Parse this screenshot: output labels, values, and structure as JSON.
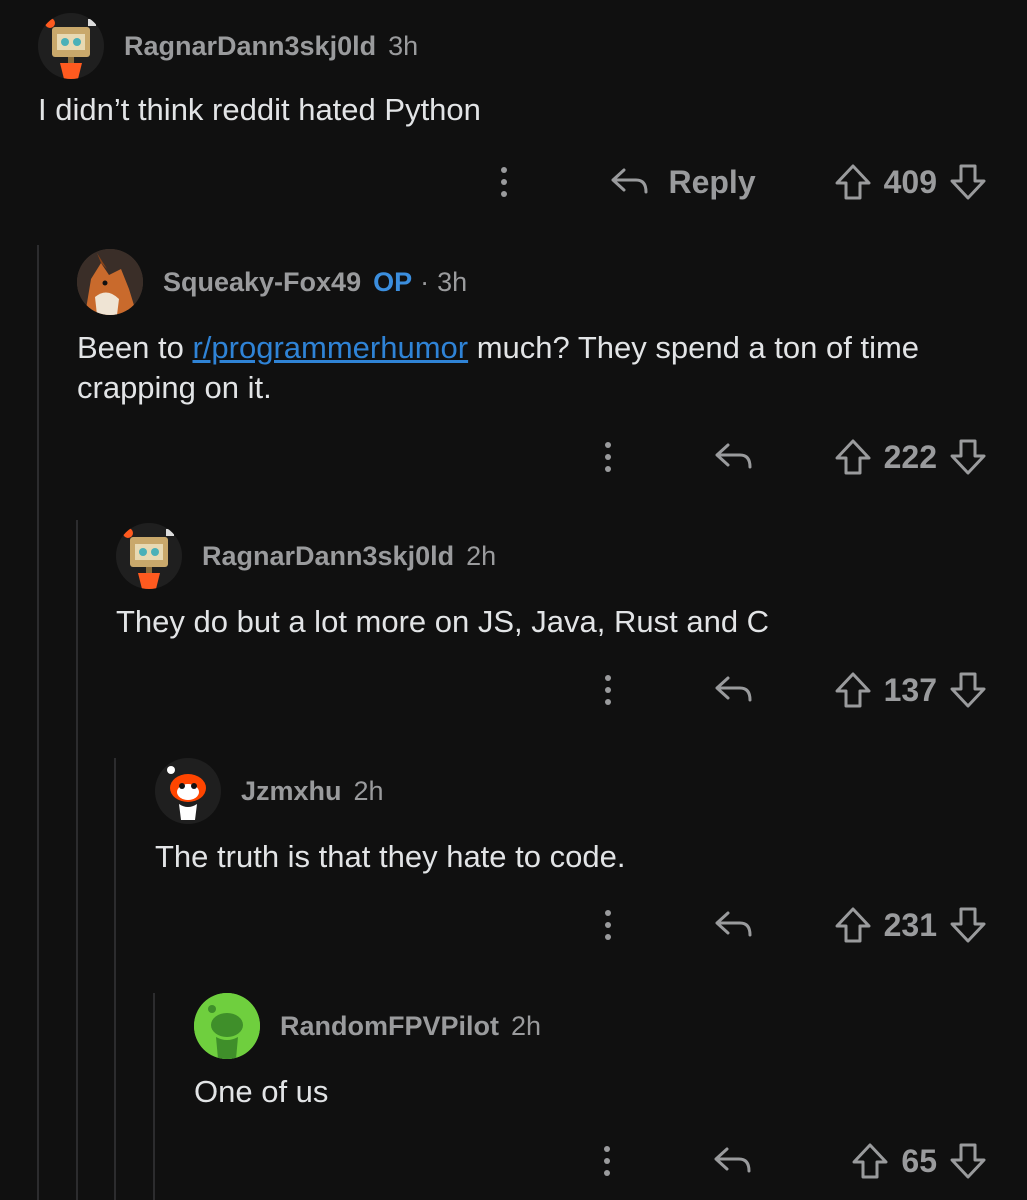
{
  "comments": [
    {
      "username": "RagnarDann3skj0ld",
      "time": "3h",
      "text": "I didn’t think reddit hated Python",
      "reply_label": "Reply",
      "votes": "409",
      "avatar": "robot-avatar"
    },
    {
      "username": "Squeaky-Fox49",
      "badge": "OP",
      "separator": "·",
      "time": "3h",
      "text_before": "Been to ",
      "link": "r/programmerhumor",
      "text_after": " much? They spend a ton of time crapping on it.",
      "votes": "222",
      "avatar": "fox-avatar"
    },
    {
      "username": "RagnarDann3skj0ld",
      "time": "2h",
      "text": "They do but a lot more on JS, Java, Rust and C",
      "votes": "137",
      "avatar": "robot-avatar"
    },
    {
      "username": "Jzmxhu",
      "time": "2h",
      "text": "The truth is that they hate to code.",
      "votes": "231",
      "avatar": "snoo-avatar"
    },
    {
      "username": "RandomFPVPilot",
      "time": "2h",
      "text": "One of us",
      "votes": "65",
      "avatar": "green-snoo-avatar"
    }
  ],
  "colors": {
    "background": "#101010",
    "meta_text": "#9a9b9d",
    "op_badge": "#3b8ede",
    "link": "#2f83d6"
  }
}
